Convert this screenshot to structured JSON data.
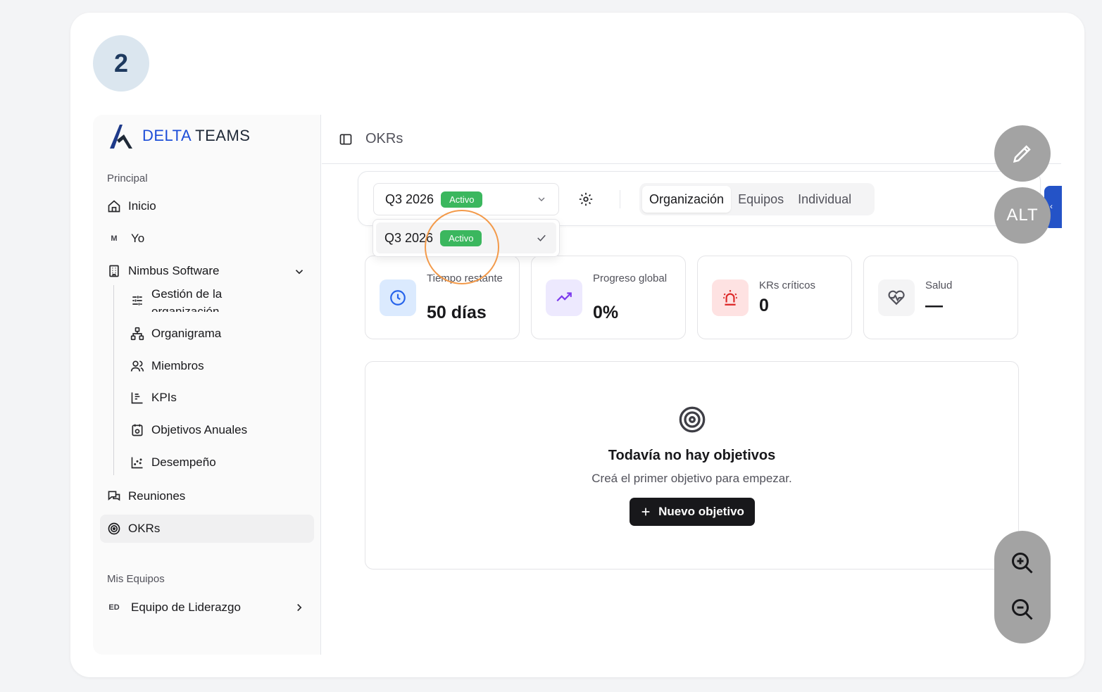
{
  "step_number": "2",
  "brand": {
    "part1": "DELTA",
    "part2": "TEAMS"
  },
  "sidebar": {
    "section_principal": "Principal",
    "inicio": "Inicio",
    "yo_avatar": "M",
    "yo": "Yo",
    "org": "Nimbus Software",
    "subitems": [
      "Gestión de la organización",
      "Organigrama",
      "Miembros",
      "KPIs",
      "Objetivos Anuales",
      "Desempeño"
    ],
    "reuniones": "Reuniones",
    "okrs": "OKRs",
    "section_equipos": "Mis Equipos",
    "team_avatar": "ED",
    "team": "Equipo de Liderazgo"
  },
  "topbar": {
    "title": "OKRs"
  },
  "filters": {
    "period": "Q3 2026",
    "period_badge": "Activo",
    "tabs": [
      "Organización",
      "Equipos",
      "Individual"
    ],
    "active_tab": "Organización"
  },
  "dropdown": {
    "option": "Q3 2026",
    "option_badge": "Activo"
  },
  "stats": [
    {
      "label": "Tiempo restante",
      "value": "50 días"
    },
    {
      "label": "Progreso global",
      "value": "0%"
    },
    {
      "label": "KRs críticos",
      "value": "0"
    },
    {
      "label": "Salud",
      "value": "—"
    }
  ],
  "empty_state": {
    "title": "Todavía no hay objetivos",
    "subtitle": "Creá el primer objetivo para empezar.",
    "button": "Nuevo objetivo"
  },
  "overlay": {
    "alt_label": "ALT"
  },
  "colors": {
    "accent_blue": "#2453c7",
    "badge_green": "#3bb75e",
    "ring_orange": "#f39a4a"
  }
}
